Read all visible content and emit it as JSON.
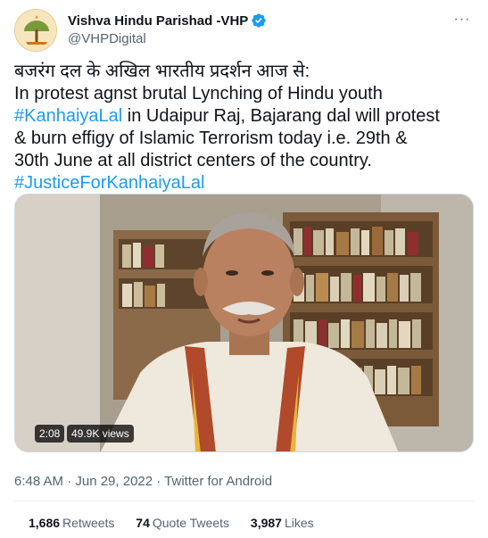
{
  "account": {
    "display_name": "Vishva Hindu Parishad -VHP",
    "handle": "@VHPDigital",
    "verified": true,
    "avatar_icon": "vhp-logo-icon"
  },
  "tweet": {
    "hindi_line": "बजरंग दल के अखिल भारतीय प्रदर्शन आज से:",
    "line_2": "In protest agnst brutal Lynching of Hindu youth",
    "hashtag_1": "#KanhaiyaLal",
    "line_3_rest": " in Udaipur Raj, Bajarang dal will protest",
    "line_4": "& burn effigy of Islamic Terrorism today i.e. 29th &",
    "line_5": "30th June at all district centers of the country.",
    "hashtag_2": "#JusticeForKanhaiyaLal"
  },
  "media": {
    "duration": "2:08",
    "views": "49.9K views"
  },
  "meta": {
    "timestamp": "6:48 AM · Jun 29, 2022 · Twitter for Android"
  },
  "stats": {
    "retweets_count": "1,686",
    "retweets_label": "Retweets",
    "quote_tweets_count": "74",
    "quote_tweets_label": "Quote Tweets",
    "likes_count": "3,987",
    "likes_label": "Likes"
  },
  "colors": {
    "link": "#1d9bf0",
    "secondary_text": "#536471",
    "primary_text": "#0f1419",
    "verified": "#1d9bf0"
  }
}
